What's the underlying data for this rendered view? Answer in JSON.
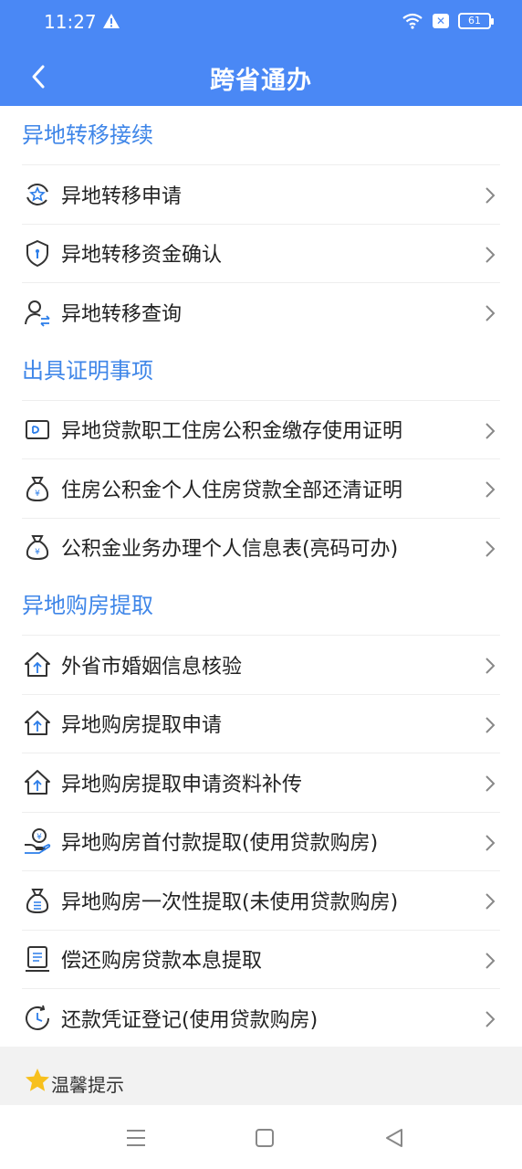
{
  "status": {
    "time": "11:27",
    "battery": "61"
  },
  "header": {
    "title": "跨省通办"
  },
  "sections": [
    {
      "title": "异地转移接续",
      "items": [
        {
          "label": "异地转移申请",
          "icon": "transfer-apply-icon"
        },
        {
          "label": "异地转移资金确认",
          "icon": "shield-confirm-icon"
        },
        {
          "label": "异地转移查询",
          "icon": "user-query-icon"
        }
      ]
    },
    {
      "title": "出具证明事项",
      "items": [
        {
          "label": "异地贷款职工住房公积金缴存使用证明",
          "icon": "card-icon"
        },
        {
          "label": "住房公积金个人住房贷款全部还清证明",
          "icon": "money-bag-icon"
        },
        {
          "label": "公积金业务办理个人信息表(亮码可办)",
          "icon": "money-bag-icon"
        }
      ]
    },
    {
      "title": "异地购房提取",
      "items": [
        {
          "label": "外省市婚姻信息核验",
          "icon": "house-arrow-icon"
        },
        {
          "label": "异地购房提取申请",
          "icon": "house-arrow-icon"
        },
        {
          "label": "异地购房提取申请资料补传",
          "icon": "house-arrow-icon"
        },
        {
          "label": "异地购房首付款提取(使用贷款购房)",
          "icon": "hand-coin-icon"
        },
        {
          "label": "异地购房一次性提取(未使用贷款购房)",
          "icon": "list-bag-icon"
        },
        {
          "label": "偿还购房贷款本息提取",
          "icon": "register-icon"
        },
        {
          "label": "还款凭证登记(使用贷款购房)",
          "icon": "clock-icon"
        }
      ]
    }
  ],
  "tips": {
    "label": "温馨提示"
  },
  "colors": {
    "brand": "#4a88f5",
    "section_title": "#3f86e8"
  }
}
